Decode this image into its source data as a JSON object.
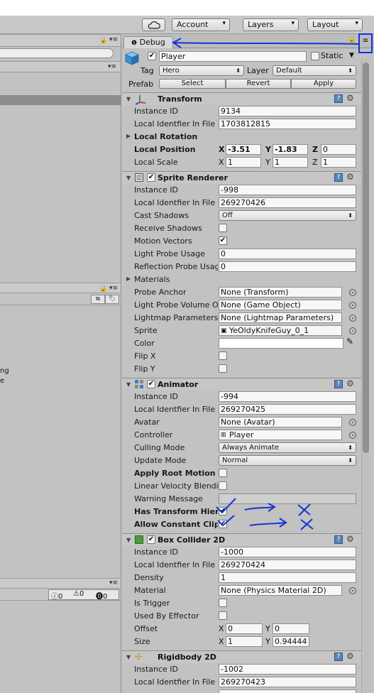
{
  "toolbar": {
    "cloud_icon": "cloud-icon",
    "account_label": "Account",
    "layers_label": "Layers",
    "layout_label": "Layout"
  },
  "left_panel": {
    "snippet_1": "ng",
    "snippet_2": "e",
    "console_counts": {
      "info": "0",
      "warning": "0",
      "error": "0"
    }
  },
  "inspector": {
    "tab_label": "Debug",
    "object_name": "Player",
    "static_label": "Static",
    "tag_label": "Tag",
    "tag_value": "Hero",
    "layer_label": "Layer",
    "layer_value": "Default",
    "prefab_label": "Prefab",
    "prefab_buttons": [
      "Select",
      "Revert",
      "Apply"
    ]
  },
  "transform": {
    "title": "Transform",
    "instance_id_label": "Instance ID",
    "instance_id": "9134",
    "local_identifier_label": "Local Identfier In File",
    "local_identifier": "1703812815",
    "local_rotation_label": "Local Rotation",
    "local_position_label": "Local Position",
    "pos": {
      "x_label": "X",
      "x": "-3.51",
      "y_label": "Y",
      "y": "-1.83",
      "z_label": "Z",
      "z": "0"
    },
    "local_scale_label": "Local Scale",
    "scale": {
      "x_label": "X",
      "x": "1",
      "y_label": "Y",
      "y": "1",
      "z_label": "Z",
      "z": "1"
    }
  },
  "sprite_renderer": {
    "title": "Sprite Renderer",
    "instance_id_label": "Instance ID",
    "instance_id": "-998",
    "local_identifier_label": "Local Identfier In File",
    "local_identifier": "269270426",
    "cast_shadows_label": "Cast Shadows",
    "cast_shadows": "Off",
    "receive_shadows_label": "Receive Shadows",
    "motion_vectors_label": "Motion Vectors",
    "light_probe_usage_label": "Light Probe Usage",
    "light_probe_usage": "0",
    "reflection_probe_label": "Reflection Probe Usage",
    "reflection_probe": "0",
    "materials_label": "Materials",
    "probe_anchor_label": "Probe Anchor",
    "probe_anchor": "None (Transform)",
    "light_probe_volume_label": "Light Probe Volume Override",
    "light_probe_volume": "None (Game Object)",
    "lightmap_params_label": "Lightmap Parameters",
    "lightmap_params": "None (Lightmap Parameters)",
    "sprite_label": "Sprite",
    "sprite": "YeOldyKnifeGuy_0_1",
    "color_label": "Color",
    "flip_x_label": "Flip X",
    "flip_y_label": "Flip Y"
  },
  "animator": {
    "title": "Animator",
    "instance_id_label": "Instance ID",
    "instance_id": "-994",
    "local_identifier_label": "Local Identfier In File",
    "local_identifier": "269270425",
    "avatar_label": "Avatar",
    "avatar": "None (Avatar)",
    "controller_label": "Controller",
    "controller": "Player",
    "culling_mode_label": "Culling Mode",
    "culling_mode": "Always Animate",
    "update_mode_label": "Update Mode",
    "update_mode": "Normal",
    "apply_root_motion_label": "Apply Root Motion",
    "linear_velocity_label": "Linear Velocity Blending",
    "warning_message_label": "Warning Message",
    "has_transform_label": "Has Transform Hierarchy",
    "allow_constant_label": "Allow Constant Clip Sampling"
  },
  "box_collider": {
    "title": "Box Collider 2D",
    "instance_id_label": "Instance ID",
    "instance_id": "-1000",
    "local_identifier_label": "Local Identfier In File",
    "local_identifier": "269270424",
    "density_label": "Density",
    "density": "1",
    "material_label": "Material",
    "material": "None (Physics Material 2D)",
    "is_trigger_label": "Is Trigger",
    "used_by_effector_label": "Used By Effector",
    "offset_label": "Offset",
    "offset": {
      "x_label": "X",
      "x": "0",
      "y_label": "Y",
      "y": "0"
    },
    "size_label": "Size",
    "size": {
      "x_label": "X",
      "x": "1",
      "y_label": "Y",
      "y": "0.94444"
    }
  },
  "rigidbody": {
    "title": "Rigidbody 2D",
    "instance_id_label": "Instance ID",
    "instance_id": "-1002",
    "local_identifier_label": "Local Identfier In File",
    "local_identifier": "269270423"
  },
  "colors": {
    "panel_bg": "#c2c2c2",
    "annotation_ink": "#1533d6",
    "help_icon": "#5a84b8"
  }
}
